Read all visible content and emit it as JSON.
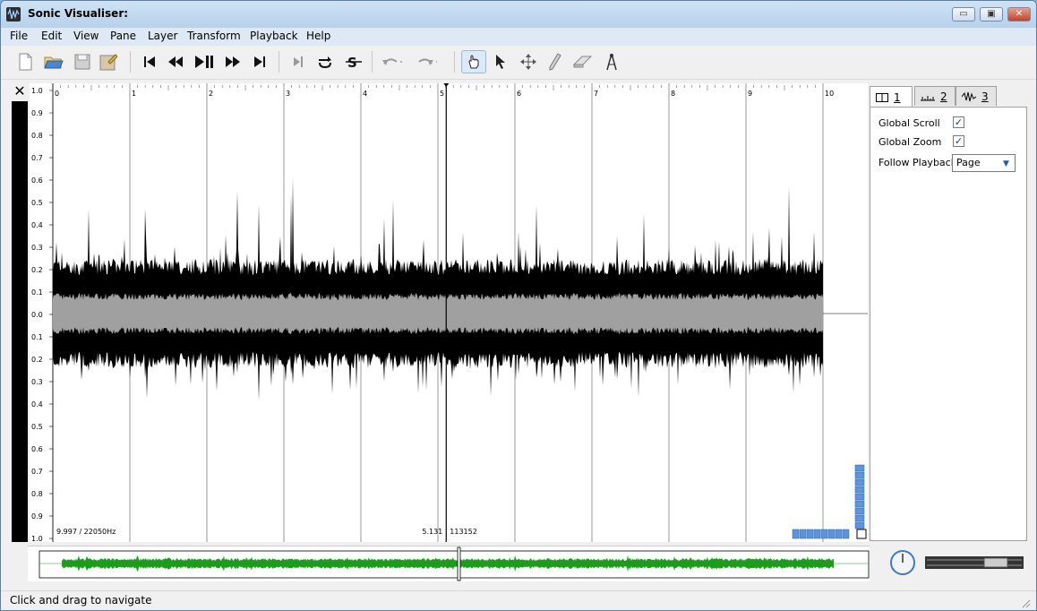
{
  "app": {
    "title": "Sonic Visualiser:"
  },
  "window_buttons": [
    "minimize",
    "maximize",
    "close"
  ],
  "menu": [
    {
      "label": "File"
    },
    {
      "label": "Edit"
    },
    {
      "label": "View"
    },
    {
      "label": "Pane"
    },
    {
      "label": "Layer"
    },
    {
      "label": "Transform"
    },
    {
      "label": "Playback"
    },
    {
      "label": "Help"
    }
  ],
  "toolbar": {
    "groups": [
      [
        "new-icon",
        "open-icon",
        "save-icon",
        "save-as-icon"
      ],
      [
        "rewind-start-icon",
        "rewind-icon",
        "play-pause-icon",
        "fast-forward-icon",
        "fast-forward-end-icon"
      ],
      [
        "play-selection-icon",
        "loop-icon",
        "solo-icon"
      ],
      [
        "undo-icon",
        "redo-icon"
      ],
      [
        "navigate-icon",
        "select-icon",
        "move-icon",
        "draw-icon",
        "erase-icon",
        "measure-icon"
      ]
    ],
    "active_tool": "navigate-icon"
  },
  "pane": {
    "y_axis_labels": [
      "1.0",
      "0.9",
      "0.8",
      "0.7",
      "0.6",
      "0.5",
      "0.4",
      "0.3",
      "0.2",
      "0.1",
      "0.0",
      "0.1",
      "0.2",
      "0.3",
      "0.4",
      "0.5",
      "0.6",
      "0.7",
      "0.8",
      "0.9",
      "1.0"
    ],
    "time_ruler_labels": [
      "0",
      "1",
      "2",
      "3",
      "4",
      "5",
      "6",
      "7",
      "8",
      "9",
      "10"
    ],
    "duration_label": "9.997 / 22050Hz",
    "playhead_time": "5.131",
    "playhead_frame": "113152",
    "waveform_colors": {
      "peak": "#000000",
      "rms": "#a0a0a0"
    }
  },
  "overview": {
    "waveform_color": "#1a9e1a"
  },
  "side_panel": {
    "tabs": [
      {
        "label": "1",
        "icon": "pane-icon"
      },
      {
        "label": "2",
        "icon": "ruler-icon"
      },
      {
        "label": "3",
        "icon": "waveform-icon"
      }
    ],
    "active_tab": 0,
    "global_scroll_label": "Global Scroll",
    "global_scroll_checked": "✓",
    "global_zoom_label": "Global Zoom",
    "global_zoom_checked": "✓",
    "follow_playback_label": "Follow Playback",
    "follow_playback_value": "Page"
  },
  "status": {
    "text": "Click and drag to navigate"
  }
}
